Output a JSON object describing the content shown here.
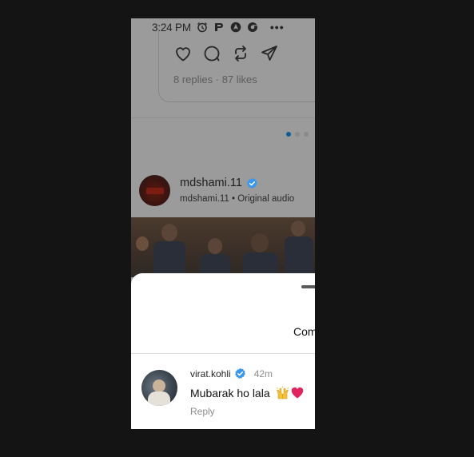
{
  "status_bar": {
    "time": "3:24 PM",
    "icons": [
      "alarm-icon",
      "paytm-p-icon",
      "navigation-icon",
      "chrome-icon"
    ],
    "more": "•••"
  },
  "post": {
    "actions": [
      "heart-icon",
      "comment-icon",
      "repost-icon",
      "share-icon"
    ],
    "stats": "8 replies · 87 likes"
  },
  "pager": {
    "total": 3,
    "active_index": 0
  },
  "reel": {
    "username": "mdshami.11",
    "subtitle": "mdshami.11 • Original audio"
  },
  "comments_sheet": {
    "title": "Com",
    "comments": [
      {
        "username": "virat.kohli",
        "time": "42m",
        "text": "Mubarak ho lala",
        "emojis": [
          "raising-hands-emoji",
          "red-heart-emoji"
        ],
        "reply_label": "Reply"
      }
    ]
  },
  "colors": {
    "dim_overlay": "#9b9b9b",
    "verified_blue": "#3897f0",
    "pager_active": "#0d5d95",
    "heart_red": "#e0245e"
  }
}
